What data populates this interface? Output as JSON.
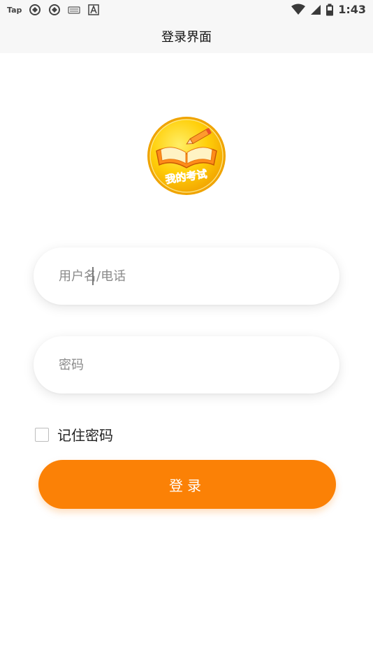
{
  "status_bar": {
    "carrier_label": "Tap",
    "time": "1:43",
    "icons": [
      "sync-icon",
      "sync-icon",
      "keyboard-icon",
      "a-icon",
      "wifi-icon",
      "signal-icon",
      "battery-icon"
    ]
  },
  "header": {
    "title": "登录界面"
  },
  "logo": {
    "text": "我的考试"
  },
  "form": {
    "username_placeholder": "用户名/电话",
    "username_value": "",
    "password_placeholder": "密码",
    "password_value": "",
    "remember_label": "记住密码",
    "remember_checked": false,
    "login_label": "登录"
  },
  "colors": {
    "accent": "#fb8106",
    "header_bg": "#f7f7f7"
  }
}
